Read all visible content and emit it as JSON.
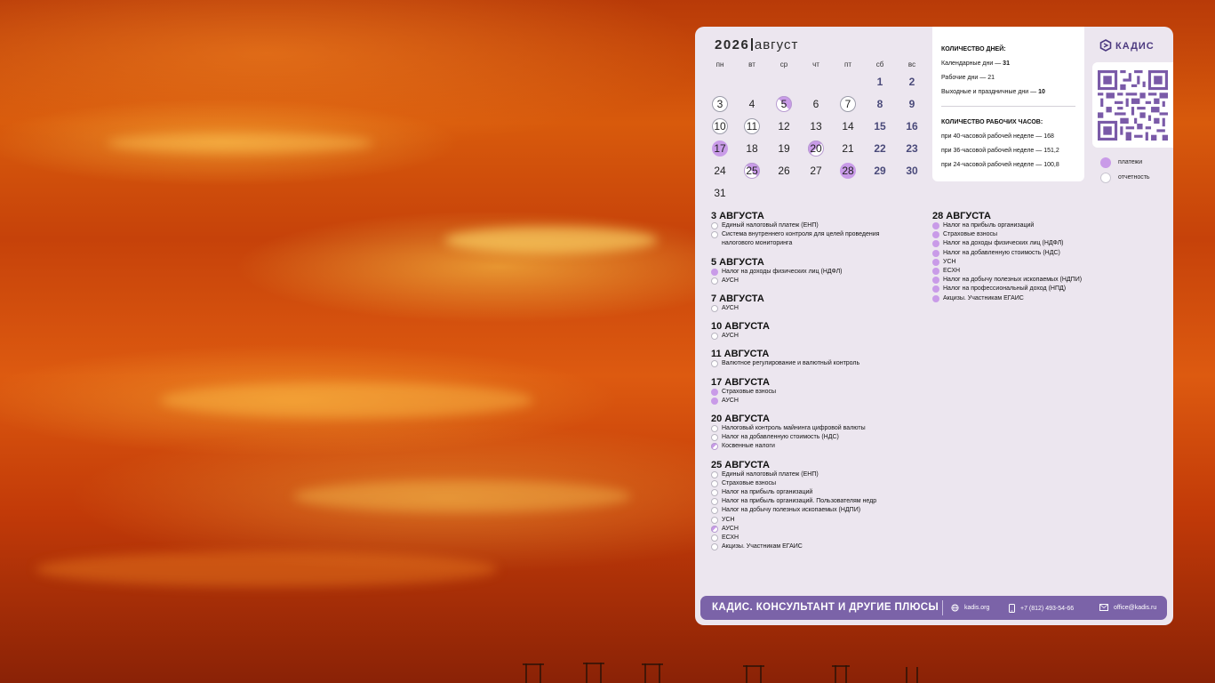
{
  "wallpaper": {
    "theme": "orange sunset sky",
    "colors": [
      "#c6420a",
      "#ffd650"
    ]
  },
  "calendar": {
    "year": "2026",
    "month": "август",
    "weekdays": [
      "пн",
      "вт",
      "ср",
      "чт",
      "пт",
      "сб",
      "вс"
    ],
    "weeks": [
      [
        {
          "d": ""
        },
        {
          "d": ""
        },
        {
          "d": ""
        },
        {
          "d": ""
        },
        {
          "d": ""
        },
        {
          "d": "1",
          "we": true
        },
        {
          "d": "2",
          "we": true
        }
      ],
      [
        {
          "d": "3",
          "m": "rep"
        },
        {
          "d": "4"
        },
        {
          "d": "5",
          "m": "halfr"
        },
        {
          "d": "6"
        },
        {
          "d": "7",
          "m": "rep"
        },
        {
          "d": "8",
          "we": true
        },
        {
          "d": "9",
          "we": true
        }
      ],
      [
        {
          "d": "10",
          "m": "rep"
        },
        {
          "d": "11",
          "m": "rep"
        },
        {
          "d": "12"
        },
        {
          "d": "13"
        },
        {
          "d": "14"
        },
        {
          "d": "15",
          "we": true
        },
        {
          "d": "16",
          "we": true
        }
      ],
      [
        {
          "d": "17",
          "m": "pay"
        },
        {
          "d": "18"
        },
        {
          "d": "19"
        },
        {
          "d": "20",
          "m": "half"
        },
        {
          "d": "21"
        },
        {
          "d": "22",
          "we": true
        },
        {
          "d": "23",
          "we": true
        }
      ],
      [
        {
          "d": "24"
        },
        {
          "d": "25",
          "m": "halfr"
        },
        {
          "d": "26"
        },
        {
          "d": "27"
        },
        {
          "d": "28",
          "m": "pay"
        },
        {
          "d": "29",
          "we": true
        },
        {
          "d": "30",
          "we": true
        }
      ],
      [
        {
          "d": "31"
        },
        {
          "d": ""
        },
        {
          "d": ""
        },
        {
          "d": ""
        },
        {
          "d": ""
        },
        {
          "d": ""
        },
        {
          "d": ""
        }
      ]
    ]
  },
  "info": {
    "days_title": "КОЛИЧЕСТВО ДНЕЙ:",
    "calendar_days": {
      "label": "Календарные дни — ",
      "value": "31"
    },
    "work_days": "Рабочие дни — 21",
    "off_days": {
      "label": "Выходные и праздничные дни — ",
      "value": "10"
    },
    "hours_title": "КОЛИЧЕСТВО РАБОЧИХ ЧАСОВ:",
    "h40": "при 40-часовой рабочей неделе — 168",
    "h36": "при 36-часовой рабочей неделе — 151,2",
    "h24": "при 24-часовой рабочей неделе — 100,8"
  },
  "logo": {
    "text": "КАДИС"
  },
  "legend": {
    "payments": {
      "label": "платежи",
      "color": "#c99be8"
    },
    "reports": {
      "label": "отчетность",
      "color": "#ffffff"
    }
  },
  "events_left": [
    {
      "date": "3 АВГУСТА",
      "items": [
        {
          "t": "Единый налоговый платеж (ЕНП)",
          "k": "rep"
        },
        {
          "t": "Система внутреннего контроля для целей проведения",
          "k": "rep"
        },
        {
          "t": "налогового мониторинга",
          "k": "none"
        }
      ]
    },
    {
      "date": "5 АВГУСТА",
      "items": [
        {
          "t": "Налог на доходы физических лиц (НДФЛ)",
          "k": "pay"
        },
        {
          "t": "АУСН",
          "k": "rep"
        }
      ]
    },
    {
      "date": "7 АВГУСТА",
      "items": [
        {
          "t": "АУСН",
          "k": "rep"
        }
      ]
    },
    {
      "date": "10 АВГУСТА",
      "items": [
        {
          "t": "АУСН",
          "k": "rep"
        }
      ]
    },
    {
      "date": "11 АВГУСТА",
      "items": [
        {
          "t": "Валютное регулирование и валютный контроль",
          "k": "rep"
        }
      ]
    },
    {
      "date": "17 АВГУСТА",
      "items": [
        {
          "t": "Страховые взносы",
          "k": "pay"
        },
        {
          "t": "АУСН",
          "k": "pay"
        }
      ]
    },
    {
      "date": "20 АВГУСТА",
      "items": [
        {
          "t": "Налоговый контроль майнинга цифровой валюты",
          "k": "rep"
        },
        {
          "t": "Налог на добавленную стоимость (НДС)",
          "k": "rep"
        },
        {
          "t": "Косвенные налоги",
          "k": "half"
        }
      ]
    },
    {
      "date": "25 АВГУСТА",
      "items": [
        {
          "t": "Единый налоговый платеж (ЕНП)",
          "k": "rep"
        },
        {
          "t": "Страховые взносы",
          "k": "rep"
        },
        {
          "t": "Налог на прибыль организаций",
          "k": "rep"
        },
        {
          "t": "Налог на прибыль организаций. Пользователям недр",
          "k": "rep"
        },
        {
          "t": "Налог на добычу полезных ископаемых (НДПИ)",
          "k": "rep"
        },
        {
          "t": "УСН",
          "k": "rep"
        },
        {
          "t": "АУСН",
          "k": "half"
        },
        {
          "t": "ЕСХН",
          "k": "rep"
        },
        {
          "t": "Акцизы. Участникам ЕГАИС",
          "k": "rep"
        }
      ]
    }
  ],
  "events_right": [
    {
      "date": "28 АВГУСТА",
      "items": [
        {
          "t": "Налог на прибыль организаций",
          "k": "pay"
        },
        {
          "t": "Страховые взносы",
          "k": "pay"
        },
        {
          "t": "Налог на доходы физических лиц (НДФЛ)",
          "k": "pay"
        },
        {
          "t": "Налог на добавленную стоимость (НДС)",
          "k": "pay"
        },
        {
          "t": "УСН",
          "k": "pay"
        },
        {
          "t": "ЕСХН",
          "k": "pay"
        },
        {
          "t": "Налог на добычу полезных ископаемых (НДПИ)",
          "k": "pay"
        },
        {
          "t": "Налог на профессиональный доход (НПД)",
          "k": "pay"
        },
        {
          "t": "Акцизы. Участникам ЕГАИС",
          "k": "pay"
        }
      ]
    }
  ],
  "footer": {
    "title": "КАДИС. КОНСУЛЬТАНТ И ДРУГИЕ ПЛЮСЫ",
    "website": "kadis.org",
    "phone": "+7 (812) 493-54-66",
    "email": "office@kadis.ru",
    "bg_color": "#7b63a8"
  }
}
